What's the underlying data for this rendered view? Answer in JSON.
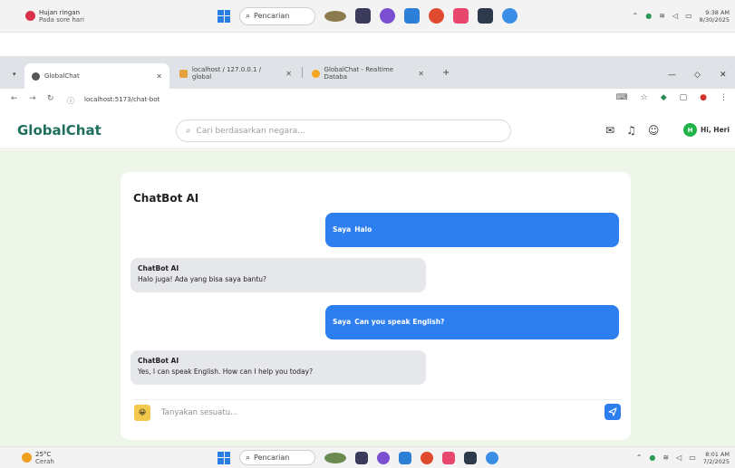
{
  "taskbar_top": {
    "weather_main": "Hujan ringan",
    "weather_sub": "Pada sore hari",
    "search_label": "Pencarian",
    "clock_time": "9:38 AM",
    "clock_date": "8/30/2025"
  },
  "browser": {
    "tabs": [
      {
        "label": "GlobalChat"
      },
      {
        "label": "localhost / 127.0.0.1 / global"
      },
      {
        "label": "GlobalChat - Realtime Databa"
      }
    ],
    "new_tab": "+",
    "url": "localhost:5173/chat-bot"
  },
  "app": {
    "logo": "GlobalChat",
    "search_placeholder": "Cari berdasarkan negara...",
    "user_initial": "H",
    "user_greeting": "Hi, Heri"
  },
  "chat": {
    "title": "ChatBot AI",
    "messages": [
      {
        "sender": "Saya",
        "text": "Halo",
        "role": "user"
      },
      {
        "sender": "ChatBot AI",
        "text": "Halo juga! Ada yang bisa saya bantu?",
        "role": "bot"
      },
      {
        "sender": "Saya",
        "text": "Can you speak English?",
        "role": "user"
      },
      {
        "sender": "ChatBot AI",
        "text": "Yes, I can speak English. How can I help you today?",
        "role": "bot"
      }
    ],
    "input_placeholder": "Tanyakan sesuatu...",
    "emoji": "😀"
  },
  "taskbar_bottom": {
    "weather_main": "25°C",
    "weather_sub": "Cerah",
    "search_label": "Pencarian",
    "clock_time": "8:01 AM",
    "clock_date": "7/2/2025"
  },
  "colors": {
    "brand": "#1f6f5c",
    "user_bubble": "#2d7ff0",
    "bot_bubble": "#e5e7ea",
    "page_bg": "#eef6ea"
  }
}
